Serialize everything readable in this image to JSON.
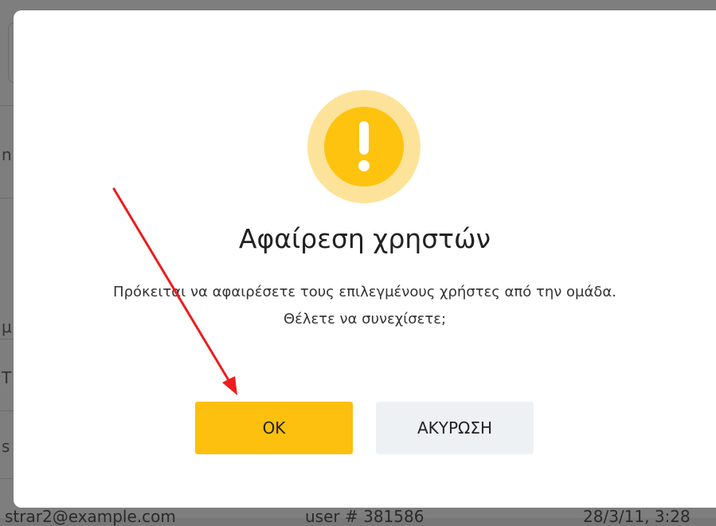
{
  "background": {
    "fragment_1": "n",
    "fragment_2": "μ",
    "fragment_3": "T",
    "fragment_4": "s",
    "row": {
      "email": "strar2@example.com",
      "user": "user # 381586",
      "date": "28/3/11, 3:28"
    }
  },
  "dialog": {
    "icon": "exclamation-icon",
    "title": "Αφαίρεση χρηστών",
    "message": "Πρόκειται να αφαιρέσετε τους επιλεγμένους χρήστες από την ομάδα. Θέλετε να συνεχίσετε;",
    "ok_label": "OK",
    "cancel_label": "ΑΚΥΡΩΣΗ"
  },
  "annotation": {
    "arrow_color": "#ee1c1c"
  },
  "colors": {
    "accent": "#fdc00f",
    "icon_ring": "#fde39a",
    "cancel_bg": "#eef1f4"
  }
}
